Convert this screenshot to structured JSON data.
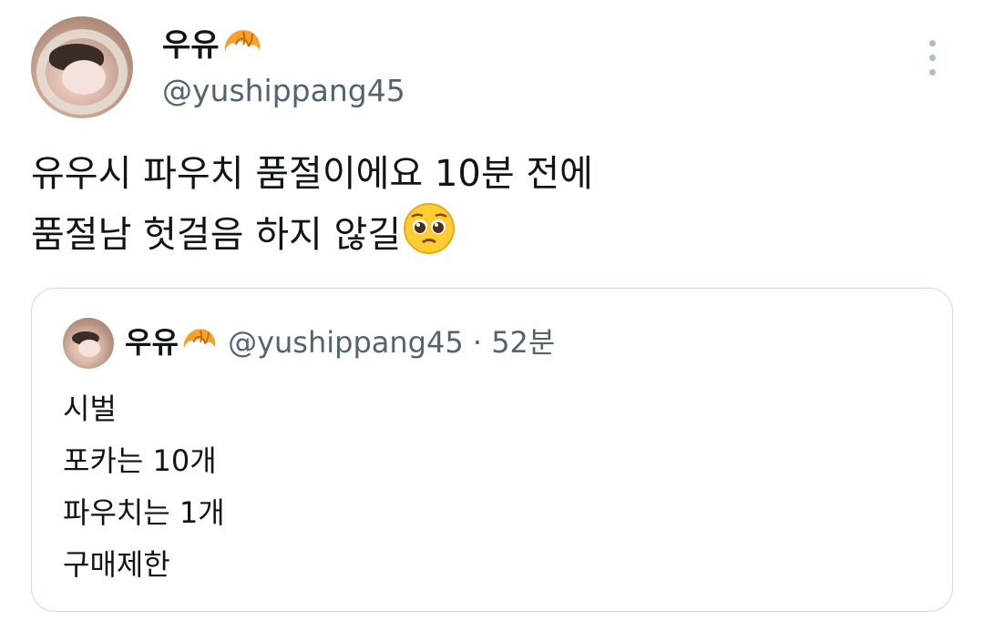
{
  "author": {
    "name": "우유",
    "handle": "@yushippang45",
    "name_emoji": "croissant-icon"
  },
  "tweet": {
    "lines": [
      "유우시 파우치 품절이에요 10분 전에",
      "품절남 헛걸음 하지 않길"
    ],
    "trailing_emoji": "pleading-face-icon"
  },
  "quoted_tweet": {
    "name": "우유",
    "handle": "@yushippang45",
    "separator": "·",
    "time": "52분",
    "lines": [
      "시벌",
      "포카는 10개",
      "파우치는 1개",
      "구매제한"
    ]
  },
  "colors": {
    "text_primary": "#0f1419",
    "text_secondary": "#536471",
    "border": "#cfd9de"
  }
}
